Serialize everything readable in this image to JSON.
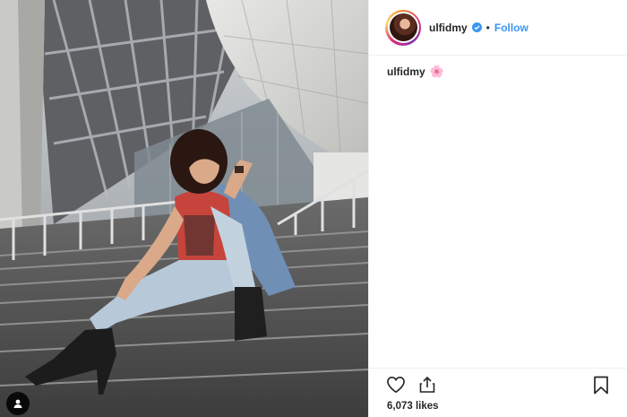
{
  "post": {
    "username": "ulfidmy",
    "separator": "•",
    "follow_label": "Follow",
    "verified": true,
    "caption": {
      "username": "ulfidmy",
      "emoji": "🌸"
    },
    "likes_text": "6,073 likes"
  },
  "icons": {
    "heart": "heart-icon",
    "share": "share-icon",
    "save": "bookmark-icon",
    "verified": "verified-badge-icon",
    "user_tag": "user-tag-icon"
  },
  "colors": {
    "follow": "#3897f0",
    "verified": "#3897f0",
    "text": "#262626",
    "divider": "#efefef"
  }
}
